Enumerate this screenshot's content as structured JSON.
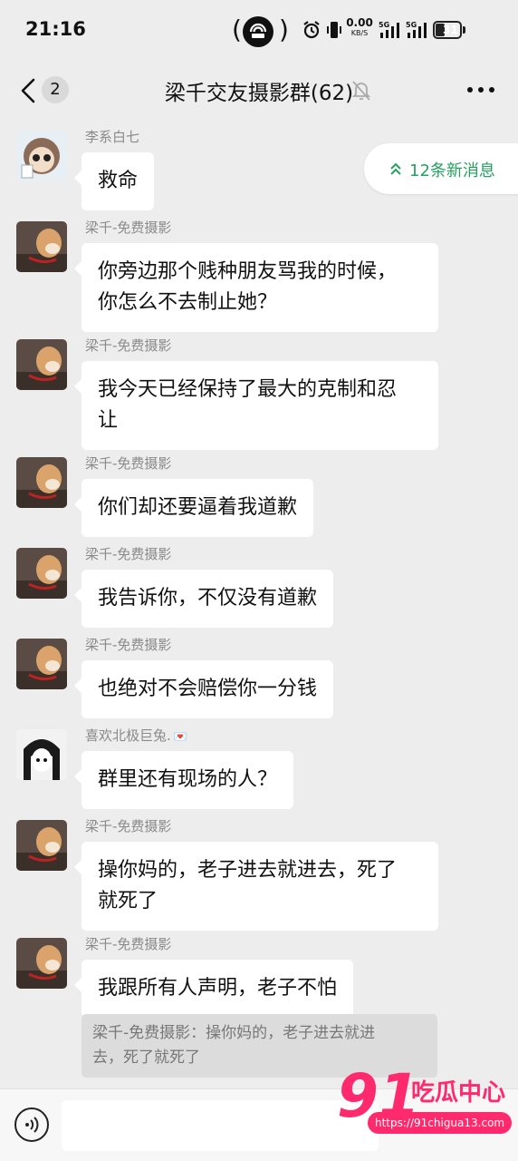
{
  "status_bar": {
    "time": "21:16",
    "net_speed": "0.00",
    "net_unit": "KB/S",
    "signal_1": "5G",
    "signal_2": "5G",
    "battery": "31"
  },
  "header": {
    "back_badge": "2",
    "title": "梁千交友摄影群(62)",
    "icons": [
      "back-chevron-icon",
      "mute-bell-icon",
      "more-dots-icon"
    ]
  },
  "new_messages": {
    "label": "12条新消息",
    "icon": "double-chevron-up-icon"
  },
  "messages": [
    {
      "sender": "李系白七",
      "text": "救命"
    },
    {
      "sender": "梁千-免费摄影",
      "lines": [
        "你旁边那个贱种朋友骂我的时候，",
        "你怎么不去制止她？"
      ]
    },
    {
      "sender": "梁千-免费摄影",
      "lines": [
        "我今天已经保持了最大的克制和忍",
        "让"
      ]
    },
    {
      "sender": "梁千-免费摄影",
      "text": "你们却还要逼着我道歉"
    },
    {
      "sender": "梁千-免费摄影",
      "text": "我告诉你，不仅没有道歉"
    },
    {
      "sender": "梁千-免费摄影",
      "text": "也绝对不会赔偿你一分钱"
    },
    {
      "sender": "喜欢北极巨兔.",
      "sender_emoji": "💌",
      "text": "群里还有现场的人？"
    },
    {
      "sender": "梁千-免费摄影",
      "lines": [
        "操你妈的，老子进去就进去，死了",
        "就死了"
      ]
    },
    {
      "sender": "梁千-免费摄影",
      "text": "我跟所有人声明，老子不怕"
    }
  ],
  "quote": {
    "lines": [
      "梁千-免费摄影：操你妈的，老子进去就进",
      "去，死了就死了"
    ]
  },
  "input_bar": {
    "placeholder": "",
    "icons": [
      "voice-icon"
    ]
  },
  "watermark": {
    "logo": "91",
    "brand": "吃瓜中心",
    "url": "https://91chigua13.com"
  },
  "colors": {
    "accent_green": "#25a160",
    "chat_bg": "#ededed",
    "bubble": "#ffffff",
    "watermark_pink": "#ff2a6e"
  }
}
